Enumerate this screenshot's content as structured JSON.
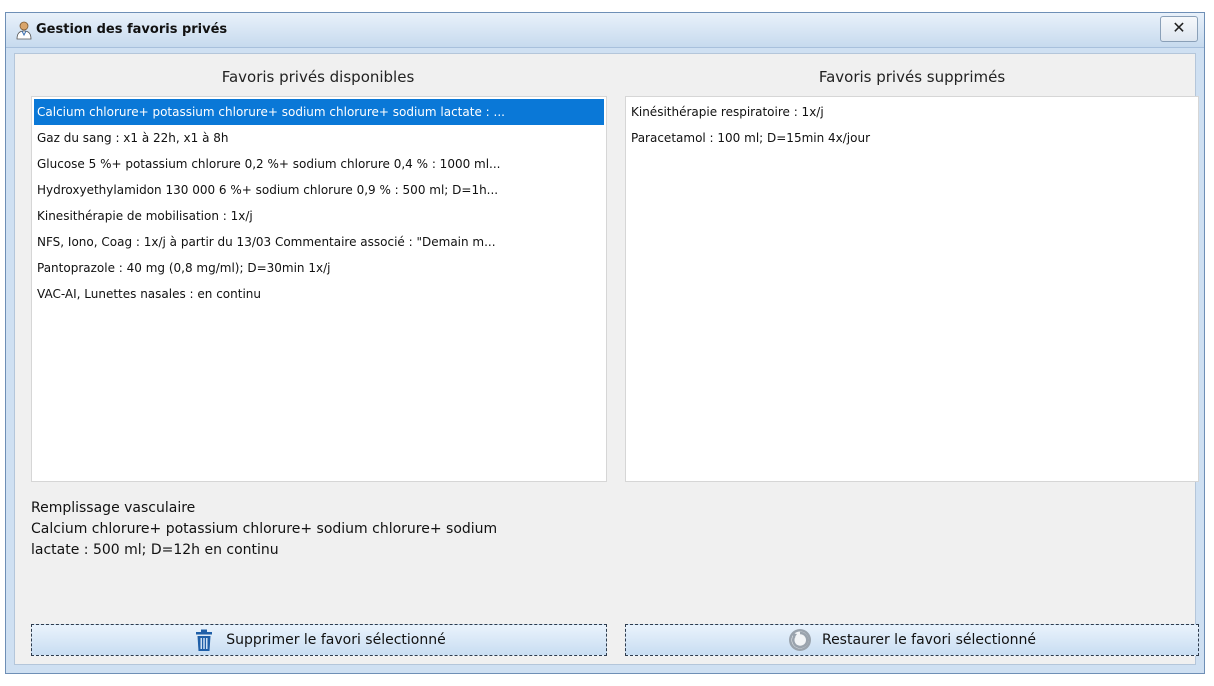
{
  "window": {
    "title": "Gestion des favoris privés",
    "close_label": "✕"
  },
  "available": {
    "title": "Favoris privés disponibles",
    "items": [
      "Calcium chlorure+ potassium chlorure+ sodium chlorure+ sodium lactate : ...",
      "Gaz du sang : x1 à 22h, x1 à 8h",
      "Glucose 5 %+ potassium chlorure 0,2 %+ sodium chlorure 0,4 % : 1000 ml...",
      "Hydroxyethylamidon 130 000 6 %+ sodium chlorure 0,9 % : 500 ml; D=1h...",
      "Kinesithérapie de mobilisation : 1x/j",
      "NFS, Iono, Coag : 1x/j à partir du 13/03 Commentaire associé : \"Demain m...",
      "Pantoprazole : 40 mg (0,8 mg/ml); D=30min 1x/j",
      "VAC-AI, Lunettes nasales : en continu"
    ],
    "selected_index": 0
  },
  "deleted": {
    "title": "Favoris privés supprimés",
    "items": [
      "Kinésithérapie respiratoire : 1x/j",
      "Paracetamol : 100 ml; D=15min 4x/jour"
    ]
  },
  "description": {
    "line1": "Remplissage vasculaire",
    "line2": "Calcium chlorure+ potassium chlorure+ sodium chlorure+ sodium",
    "line3": "lactate : 500 ml; D=12h en continu"
  },
  "buttons": {
    "delete_label": "Supprimer le favori sélectionné",
    "restore_label": "Restaurer le favori sélectionné"
  },
  "colors": {
    "selection": "#0a78d7",
    "trash_icon": "#1f5fa8",
    "restore_icon": "#9aa3ad"
  }
}
